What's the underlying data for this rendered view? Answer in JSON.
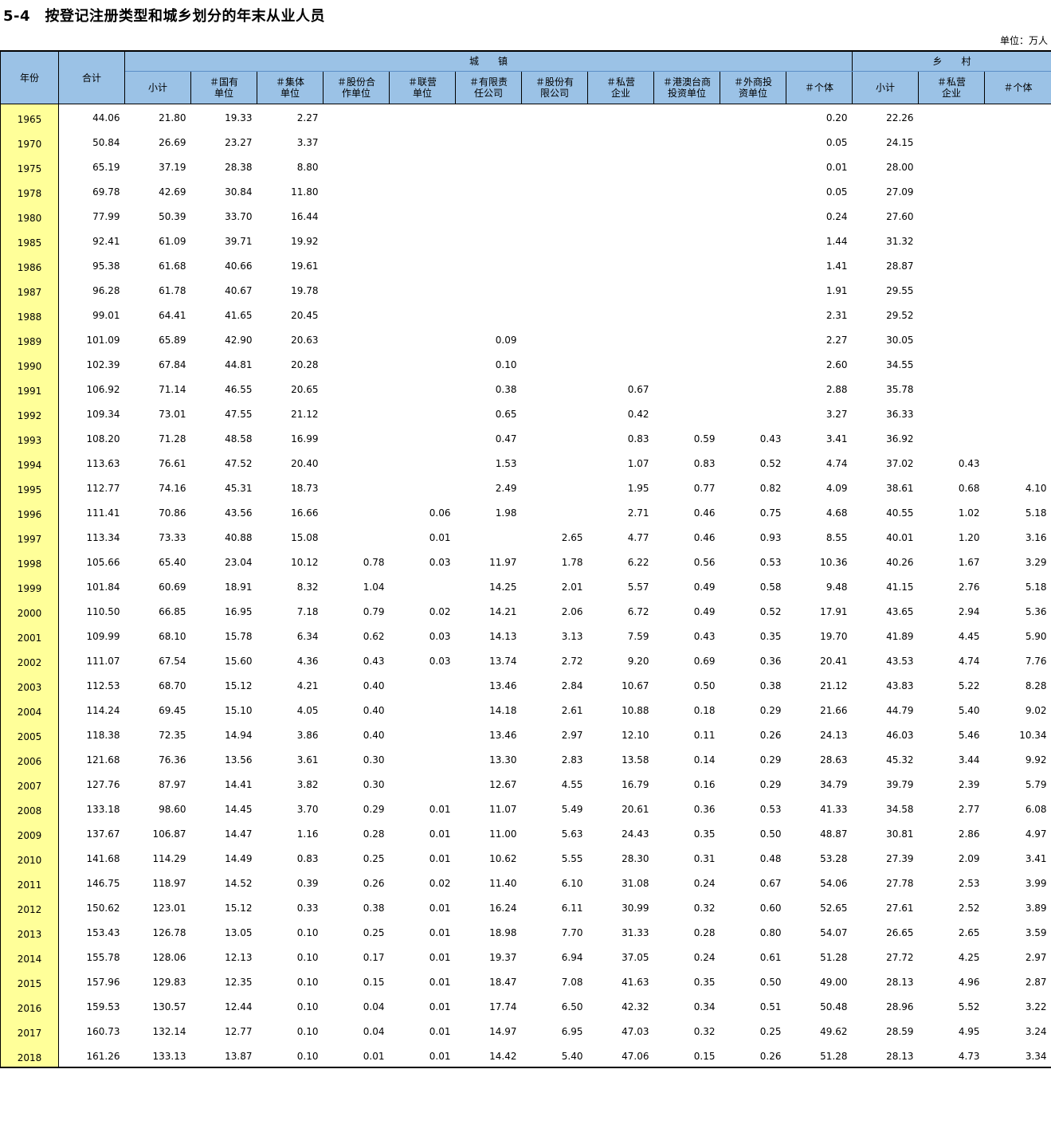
{
  "title": "5-4　按登记注册类型和城乡划分的年末从业人员",
  "unit": "单位：万人",
  "header": {
    "year": "年份",
    "total": "合计",
    "urban": "城　　镇",
    "rural": "乡　　村",
    "urban_cols": [
      [
        "小计"
      ],
      [
        "＃国有",
        "单位"
      ],
      [
        "＃集体",
        "单位"
      ],
      [
        "＃股份合",
        "作单位"
      ],
      [
        "＃联营",
        "单位"
      ],
      [
        "＃有限责",
        "任公司"
      ],
      [
        "＃股份有",
        "限公司"
      ],
      [
        "＃私营",
        "企业"
      ],
      [
        "＃港澳台商",
        "投资单位"
      ],
      [
        "＃外商投",
        "资单位"
      ],
      [
        "＃个体"
      ]
    ],
    "rural_cols": [
      [
        "小计"
      ],
      [
        "＃私营",
        "企业"
      ],
      [
        "＃个体"
      ]
    ]
  },
  "rows": [
    [
      "1965",
      "44.06",
      "21.80",
      "19.33",
      "2.27",
      "",
      "",
      "",
      "",
      "",
      "",
      "",
      "0.20",
      "22.26",
      "",
      ""
    ],
    [
      "1970",
      "50.84",
      "26.69",
      "23.27",
      "3.37",
      "",
      "",
      "",
      "",
      "",
      "",
      "",
      "0.05",
      "24.15",
      "",
      ""
    ],
    [
      "1975",
      "65.19",
      "37.19",
      "28.38",
      "8.80",
      "",
      "",
      "",
      "",
      "",
      "",
      "",
      "0.01",
      "28.00",
      "",
      ""
    ],
    [
      "1978",
      "69.78",
      "42.69",
      "30.84",
      "11.80",
      "",
      "",
      "",
      "",
      "",
      "",
      "",
      "0.05",
      "27.09",
      "",
      ""
    ],
    [
      "1980",
      "77.99",
      "50.39",
      "33.70",
      "16.44",
      "",
      "",
      "",
      "",
      "",
      "",
      "",
      "0.24",
      "27.60",
      "",
      ""
    ],
    [
      "1985",
      "92.41",
      "61.09",
      "39.71",
      "19.92",
      "",
      "",
      "",
      "",
      "",
      "",
      "",
      "1.44",
      "31.32",
      "",
      ""
    ],
    [
      "1986",
      "95.38",
      "61.68",
      "40.66",
      "19.61",
      "",
      "",
      "",
      "",
      "",
      "",
      "",
      "1.41",
      "28.87",
      "",
      ""
    ],
    [
      "1987",
      "96.28",
      "61.78",
      "40.67",
      "19.78",
      "",
      "",
      "",
      "",
      "",
      "",
      "",
      "1.91",
      "29.55",
      "",
      ""
    ],
    [
      "1988",
      "99.01",
      "64.41",
      "41.65",
      "20.45",
      "",
      "",
      "",
      "",
      "",
      "",
      "",
      "2.31",
      "29.52",
      "",
      ""
    ],
    [
      "1989",
      "101.09",
      "65.89",
      "42.90",
      "20.63",
      "",
      "",
      "0.09",
      "",
      "",
      "",
      "",
      "2.27",
      "30.05",
      "",
      ""
    ],
    [
      "1990",
      "102.39",
      "67.84",
      "44.81",
      "20.28",
      "",
      "",
      "0.10",
      "",
      "",
      "",
      "",
      "2.60",
      "34.55",
      "",
      ""
    ],
    [
      "1991",
      "106.92",
      "71.14",
      "46.55",
      "20.65",
      "",
      "",
      "0.38",
      "",
      "0.67",
      "",
      "",
      "2.88",
      "35.78",
      "",
      ""
    ],
    [
      "1992",
      "109.34",
      "73.01",
      "47.55",
      "21.12",
      "",
      "",
      "0.65",
      "",
      "0.42",
      "",
      "",
      "3.27",
      "36.33",
      "",
      ""
    ],
    [
      "1993",
      "108.20",
      "71.28",
      "48.58",
      "16.99",
      "",
      "",
      "0.47",
      "",
      "0.83",
      "0.59",
      "0.43",
      "3.41",
      "36.92",
      "",
      ""
    ],
    [
      "1994",
      "113.63",
      "76.61",
      "47.52",
      "20.40",
      "",
      "",
      "1.53",
      "",
      "1.07",
      "0.83",
      "0.52",
      "4.74",
      "37.02",
      "0.43",
      ""
    ],
    [
      "1995",
      "112.77",
      "74.16",
      "45.31",
      "18.73",
      "",
      "",
      "2.49",
      "",
      "1.95",
      "0.77",
      "0.82",
      "4.09",
      "38.61",
      "0.68",
      "4.10"
    ],
    [
      "1996",
      "111.41",
      "70.86",
      "43.56",
      "16.66",
      "",
      "0.06",
      "1.98",
      "",
      "2.71",
      "0.46",
      "0.75",
      "4.68",
      "40.55",
      "1.02",
      "5.18"
    ],
    [
      "1997",
      "113.34",
      "73.33",
      "40.88",
      "15.08",
      "",
      "0.01",
      "",
      "2.65",
      "4.77",
      "0.46",
      "0.93",
      "8.55",
      "40.01",
      "1.20",
      "3.16"
    ],
    [
      "1998",
      "105.66",
      "65.40",
      "23.04",
      "10.12",
      "0.78",
      "0.03",
      "11.97",
      "1.78",
      "6.22",
      "0.56",
      "0.53",
      "10.36",
      "40.26",
      "1.67",
      "3.29"
    ],
    [
      "1999",
      "101.84",
      "60.69",
      "18.91",
      "8.32",
      "1.04",
      "",
      "14.25",
      "2.01",
      "5.57",
      "0.49",
      "0.58",
      "9.48",
      "41.15",
      "2.76",
      "5.18"
    ],
    [
      "2000",
      "110.50",
      "66.85",
      "16.95",
      "7.18",
      "0.79",
      "0.02",
      "14.21",
      "2.06",
      "6.72",
      "0.49",
      "0.52",
      "17.91",
      "43.65",
      "2.94",
      "5.36"
    ],
    [
      "2001",
      "109.99",
      "68.10",
      "15.78",
      "6.34",
      "0.62",
      "0.03",
      "14.13",
      "3.13",
      "7.59",
      "0.43",
      "0.35",
      "19.70",
      "41.89",
      "4.45",
      "5.90"
    ],
    [
      "2002",
      "111.07",
      "67.54",
      "15.60",
      "4.36",
      "0.43",
      "0.03",
      "13.74",
      "2.72",
      "9.20",
      "0.69",
      "0.36",
      "20.41",
      "43.53",
      "4.74",
      "7.76"
    ],
    [
      "2003",
      "112.53",
      "68.70",
      "15.12",
      "4.21",
      "0.40",
      "",
      "13.46",
      "2.84",
      "10.67",
      "0.50",
      "0.38",
      "21.12",
      "43.83",
      "5.22",
      "8.28"
    ],
    [
      "2004",
      "114.24",
      "69.45",
      "15.10",
      "4.05",
      "0.40",
      "",
      "14.18",
      "2.61",
      "10.88",
      "0.18",
      "0.29",
      "21.66",
      "44.79",
      "5.40",
      "9.02"
    ],
    [
      "2005",
      "118.38",
      "72.35",
      "14.94",
      "3.86",
      "0.40",
      "",
      "13.46",
      "2.97",
      "12.10",
      "0.11",
      "0.26",
      "24.13",
      "46.03",
      "5.46",
      "10.34"
    ],
    [
      "2006",
      "121.68",
      "76.36",
      "13.56",
      "3.61",
      "0.30",
      "",
      "13.30",
      "2.83",
      "13.58",
      "0.14",
      "0.29",
      "28.63",
      "45.32",
      "3.44",
      "9.92"
    ],
    [
      "2007",
      "127.76",
      "87.97",
      "14.41",
      "3.82",
      "0.30",
      "",
      "12.67",
      "4.55",
      "16.79",
      "0.16",
      "0.29",
      "34.79",
      "39.79",
      "2.39",
      "5.79"
    ],
    [
      "2008",
      "133.18",
      "98.60",
      "14.45",
      "3.70",
      "0.29",
      "0.01",
      "11.07",
      "5.49",
      "20.61",
      "0.36",
      "0.53",
      "41.33",
      "34.58",
      "2.77",
      "6.08"
    ],
    [
      "2009",
      "137.67",
      "106.87",
      "14.47",
      "1.16",
      "0.28",
      "0.01",
      "11.00",
      "5.63",
      "24.43",
      "0.35",
      "0.50",
      "48.87",
      "30.81",
      "2.86",
      "4.97"
    ],
    [
      "2010",
      "141.68",
      "114.29",
      "14.49",
      "0.83",
      "0.25",
      "0.01",
      "10.62",
      "5.55",
      "28.30",
      "0.31",
      "0.48",
      "53.28",
      "27.39",
      "2.09",
      "3.41"
    ],
    [
      "2011",
      "146.75",
      "118.97",
      "14.52",
      "0.39",
      "0.26",
      "0.02",
      "11.40",
      "6.10",
      "31.08",
      "0.24",
      "0.67",
      "54.06",
      "27.78",
      "2.53",
      "3.99"
    ],
    [
      "2012",
      "150.62",
      "123.01",
      "15.12",
      "0.33",
      "0.38",
      "0.01",
      "16.24",
      "6.11",
      "30.99",
      "0.32",
      "0.60",
      "52.65",
      "27.61",
      "2.52",
      "3.89"
    ],
    [
      "2013",
      "153.43",
      "126.78",
      "13.05",
      "0.10",
      "0.25",
      "0.01",
      "18.98",
      "7.70",
      "31.33",
      "0.28",
      "0.80",
      "54.07",
      "26.65",
      "2.65",
      "3.59"
    ],
    [
      "2014",
      "155.78",
      "128.06",
      "12.13",
      "0.10",
      "0.17",
      "0.01",
      "19.37",
      "6.94",
      "37.05",
      "0.24",
      "0.61",
      "51.28",
      "27.72",
      "4.25",
      "2.97"
    ],
    [
      "2015",
      "157.96",
      "129.83",
      "12.35",
      "0.10",
      "0.15",
      "0.01",
      "18.47",
      "7.08",
      "41.63",
      "0.35",
      "0.50",
      "49.00",
      "28.13",
      "4.96",
      "2.87"
    ],
    [
      "2016",
      "159.53",
      "130.57",
      "12.44",
      "0.10",
      "0.04",
      "0.01",
      "17.74",
      "6.50",
      "42.32",
      "0.34",
      "0.51",
      "50.48",
      "28.96",
      "5.52",
      "3.22"
    ],
    [
      "2017",
      "160.73",
      "132.14",
      "12.77",
      "0.10",
      "0.04",
      "0.01",
      "14.97",
      "6.95",
      "47.03",
      "0.32",
      "0.25",
      "49.62",
      "28.59",
      "4.95",
      "3.24"
    ],
    [
      "2018",
      "161.26",
      "133.13",
      "13.87",
      "0.10",
      "0.01",
      "0.01",
      "14.42",
      "5.40",
      "47.06",
      "0.15",
      "0.26",
      "51.28",
      "28.13",
      "4.73",
      "3.34"
    ]
  ]
}
